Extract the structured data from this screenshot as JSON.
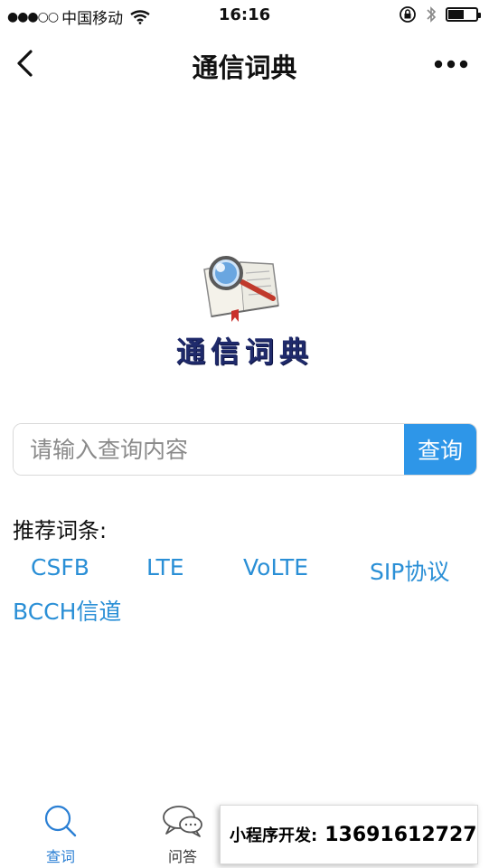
{
  "status_bar": {
    "signal": "●●●○○",
    "carrier": "中国移动",
    "time": "16:16",
    "battery_level": 0.55
  },
  "nav": {
    "title": "通信词典"
  },
  "logo": {
    "text": "通信词典"
  },
  "search": {
    "placeholder": "请输入查询内容",
    "button_label": "查询"
  },
  "recommend": {
    "heading": "推荐词条:",
    "terms": [
      "CSFB",
      "LTE",
      "VoLTE",
      "SIP协议",
      "BCCH信道"
    ]
  },
  "tab_bar": {
    "tabs": [
      {
        "label": "查词",
        "icon": "search-icon",
        "active": true
      },
      {
        "label": "问答",
        "icon": "chat-bubbles-icon",
        "active": false
      },
      {
        "label": "",
        "icon": "document-icon",
        "active": false
      },
      {
        "label": "",
        "icon": "user-icon",
        "active": false
      }
    ],
    "active_color": "#2a7fd4"
  },
  "banner": {
    "label": "小程序开发:",
    "phone": "13691612727"
  },
  "colors": {
    "accent": "#2e96e8",
    "link": "#2a8fd6",
    "logo_text": "#1f2a6b"
  }
}
